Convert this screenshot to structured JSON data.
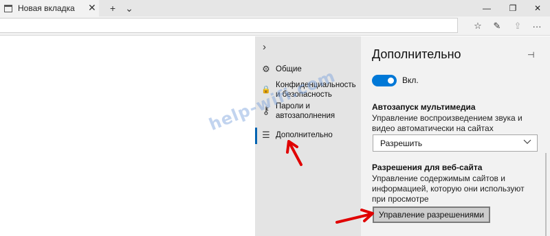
{
  "tab": {
    "title": "Новая вкладка",
    "close": "✕"
  },
  "titlebar": {
    "new_tab": "+",
    "tab_list": "⌄",
    "minimize": "—",
    "restore": "❐",
    "close": "✕"
  },
  "navbar": {
    "address_value": "",
    "favorites": "☆",
    "notes": "✎",
    "share": "⇪",
    "more": "···"
  },
  "settings_nav": {
    "collapse": "›",
    "items": [
      {
        "label": "Общие",
        "icon": "gear-icon",
        "glyph": "⚙"
      },
      {
        "label": "Конфиденциальность и безопасность",
        "icon": "lock-icon",
        "glyph": "🔒"
      },
      {
        "label": "Пароли и автозаполнения",
        "icon": "key-icon",
        "glyph": "⚷"
      },
      {
        "label": "Дополнительно",
        "icon": "sliders-icon",
        "glyph": "☰"
      }
    ]
  },
  "panel": {
    "title": "Дополнительно",
    "pin": "⊣",
    "toggle_label": "Вкл.",
    "autoplay_title": "Автозапуск мультимедиа",
    "autoplay_desc": "Управление воспроизведением звука и видео автоматически на сайтах",
    "autoplay_value": "Разрешить",
    "perm_title": "Разрешения для веб-сайта",
    "perm_desc": "Управление содержимым сайтов и информацией, которую они используют при просмотре",
    "perm_button": "Управление разрешениями"
  },
  "watermark": "help-wifi.com",
  "colors": {
    "accent": "#0078d7",
    "arrow": "#e00000",
    "nav_bg": "#e4e4e4",
    "panel_bg": "#f2f2f2"
  }
}
